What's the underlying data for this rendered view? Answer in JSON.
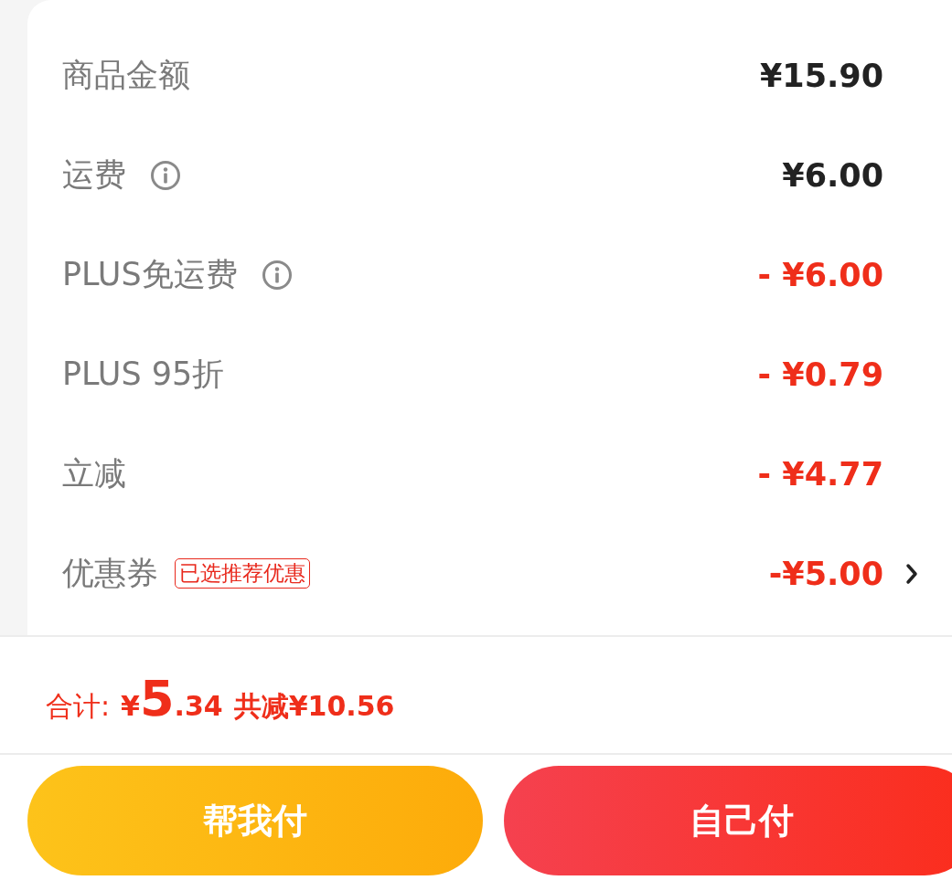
{
  "rows": [
    {
      "label": "商品金额",
      "amount": "¥15.90",
      "kind": "normal",
      "info": false
    },
    {
      "label": "运费",
      "amount": "¥6.00",
      "kind": "normal",
      "info": true
    },
    {
      "label": "PLUS免运费",
      "amount": "- ¥6.00",
      "kind": "discount",
      "info": true
    },
    {
      "label": "PLUS 95折",
      "amount": "- ¥0.79",
      "kind": "discount",
      "info": false
    },
    {
      "label": "立减",
      "amount": "- ¥4.77",
      "kind": "discount",
      "info": false
    },
    {
      "label": "优惠券",
      "tag": "已选推荐优惠",
      "amount": "-¥5.00",
      "kind": "discount",
      "info": false,
      "arrow": true
    }
  ],
  "total": {
    "label": "合计:",
    "currency": "¥",
    "integer": "5",
    "decimal": ".34",
    "saved": "共减¥10.56"
  },
  "buttons": [
    {
      "label": "帮我付",
      "kind": "friend"
    },
    {
      "label": "自己付",
      "kind": "self"
    }
  ]
}
